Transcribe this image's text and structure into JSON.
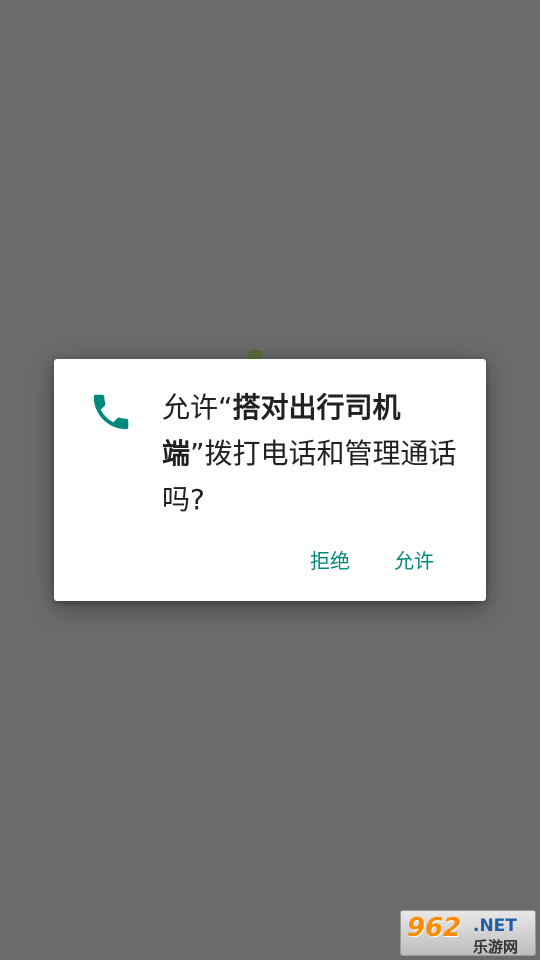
{
  "dialog": {
    "icon": "phone-icon",
    "message_prefix": "允许“",
    "app_name": "搭对出行司机端",
    "message_suffix": "”拨打电话和管理通话吗?",
    "deny_label": "拒绝",
    "allow_label": "允许",
    "accent_color": "#00897b"
  },
  "watermark": {
    "number": "962",
    "domain": ".NET",
    "subtitle": "乐游网"
  }
}
